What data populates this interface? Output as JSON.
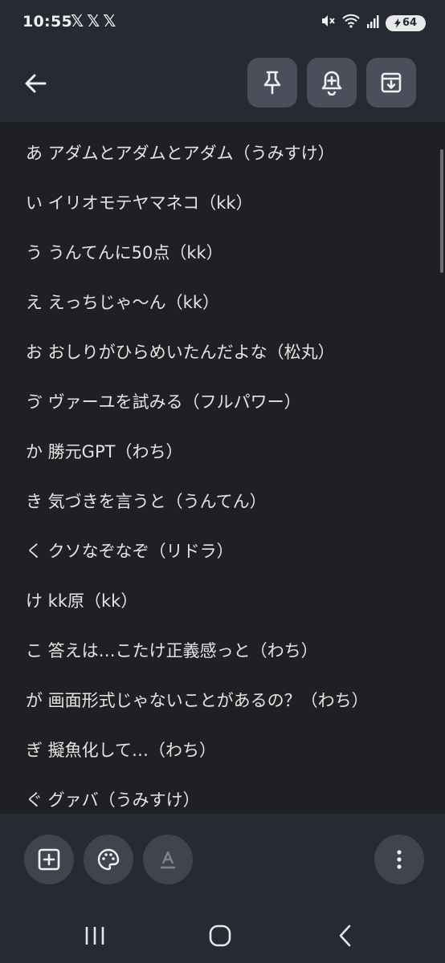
{
  "status": {
    "time": "10:55",
    "x_icons": "𝕏𝕏𝕏",
    "battery": "64"
  },
  "toolbar": {
    "back_icon": "arrow-left-icon",
    "pin_icon": "pin-icon",
    "reminder_icon": "bell-plus-icon",
    "archive_icon": "archive-icon"
  },
  "note": {
    "lines": [
      "あ アダムとアダムとアダム（うみすけ）",
      "い イリオモテヤマネコ（kk）",
      "う うんてんに50点（kk）",
      "え えっちじゃ〜ん（kk）",
      "お おしりがひらめいたんだよな（松丸）",
      "ゔ ヴァーユを試みる（フルパワー）",
      "か 勝元GPT（わち）",
      "き 気づきを言うと（うんてん）",
      "く クソなぞなぞ（リドラ）",
      "け kk原（kk）",
      "こ 答えは…こたけ正義感っと（わち）",
      "が 画面形式じゃないことがあるの？（わち）",
      "ぎ 擬魚化して…（わち）",
      "ぐ グァバ（うみすけ）"
    ]
  },
  "bottom": {
    "add_icon": "add-box-icon",
    "palette_icon": "palette-icon",
    "text_format_icon": "text-format-icon",
    "more_icon": "more-vert-icon"
  },
  "colors": {
    "background": "#1f2023",
    "bar": "#262a33",
    "button": "#4a4f5b"
  }
}
